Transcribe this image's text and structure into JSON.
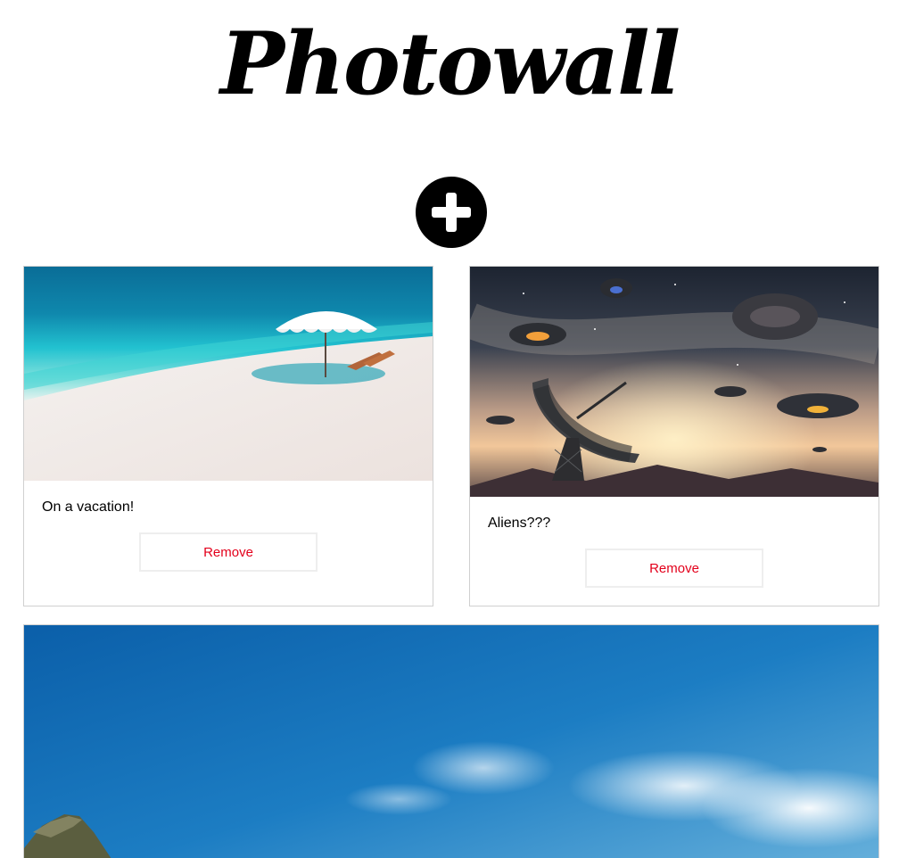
{
  "header": {
    "title": "Photowall"
  },
  "add_button": {
    "icon": "plus-icon"
  },
  "posts": [
    {
      "caption": "On a vacation!",
      "remove_label": "Remove",
      "image": "beach-umbrella-photo"
    },
    {
      "caption": "Aliens???",
      "remove_label": "Remove",
      "image": "ufo-radio-telescope-photo"
    },
    {
      "caption": "",
      "image": "blue-sky-mountain-photo"
    }
  ],
  "colors": {
    "remove_text": "#e3001b",
    "card_border": "#d0d0d0",
    "title": "#000000"
  }
}
